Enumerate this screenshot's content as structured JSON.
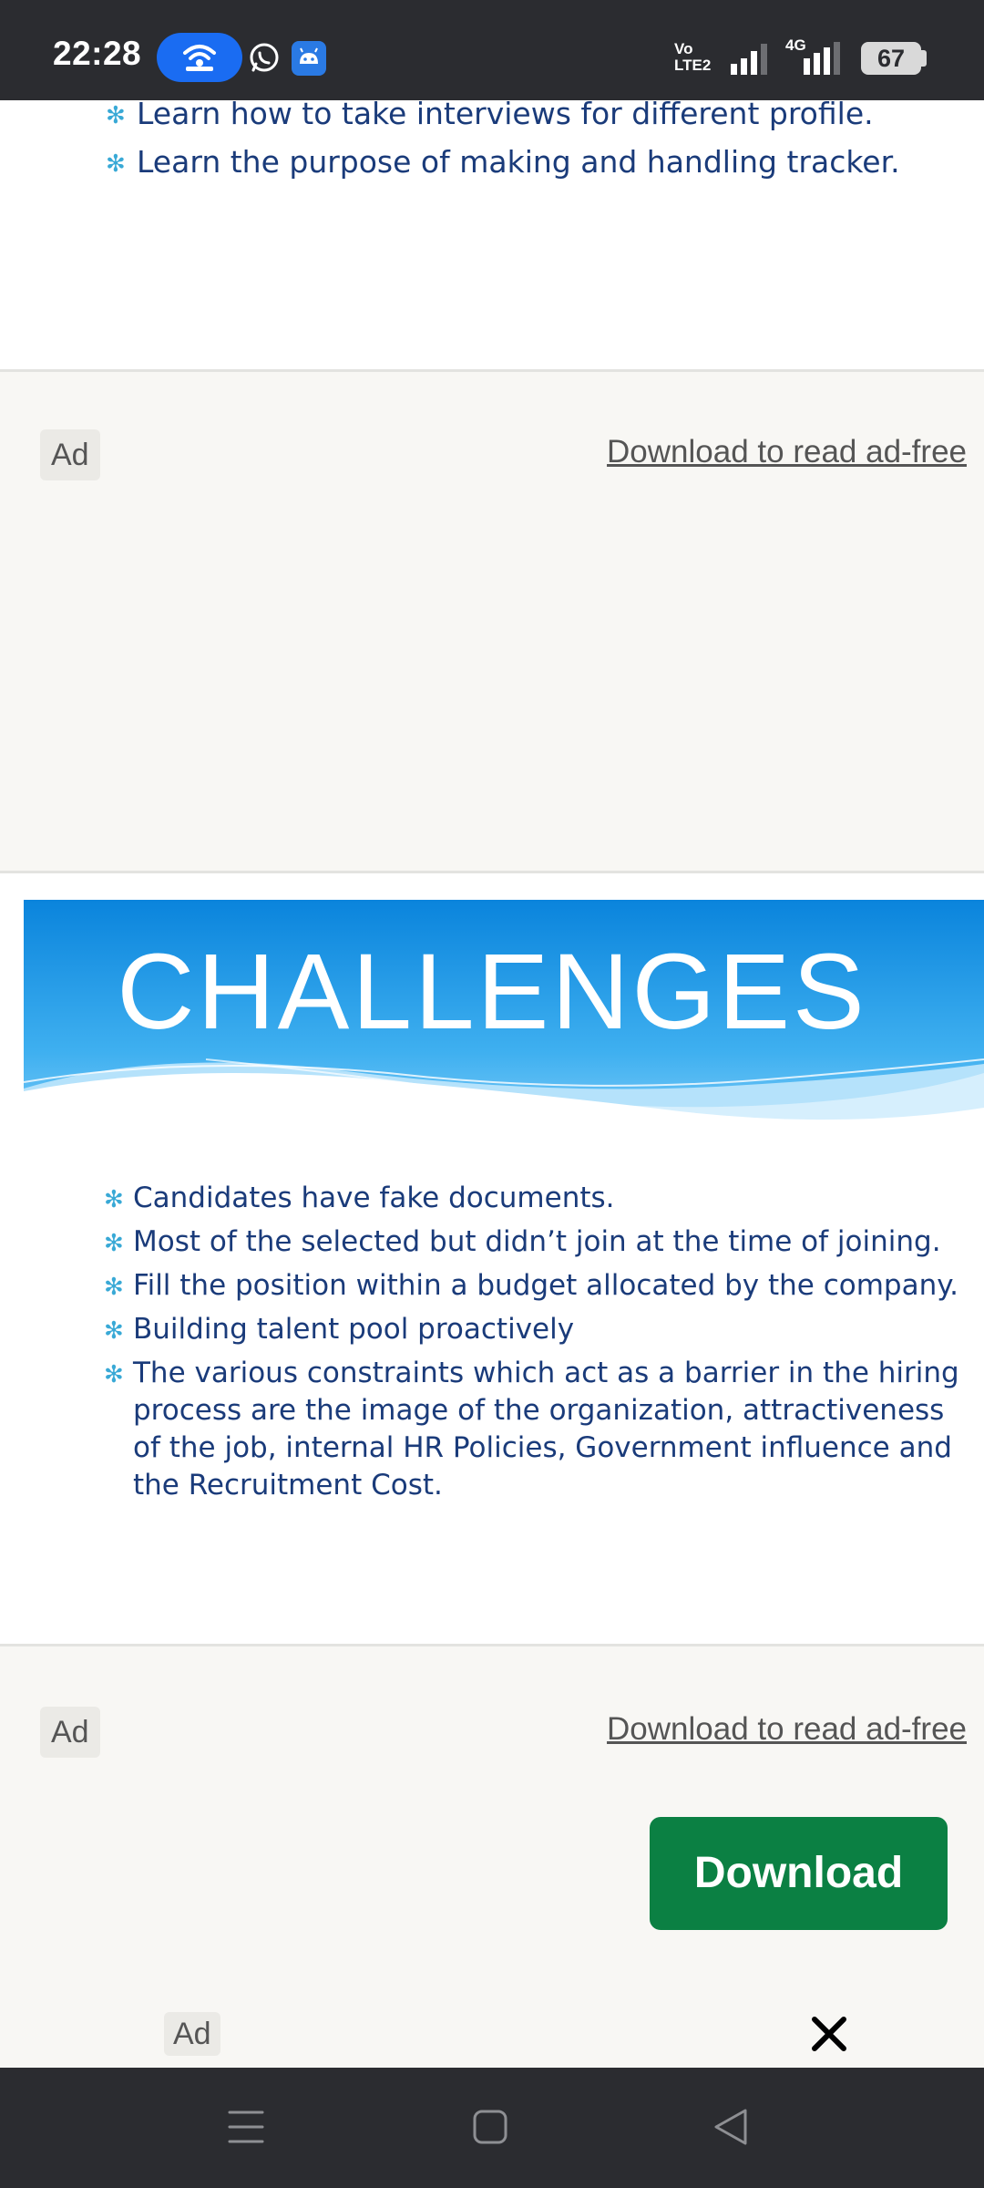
{
  "status_bar": {
    "time": "22:28",
    "volte_top": "Vo",
    "volte_bottom": "LTE2",
    "network_label": "4G",
    "battery": "67"
  },
  "slide_top": {
    "bullets": [
      "Learn how to take interviews for different profile.",
      "Learn the purpose of making and handling tracker."
    ]
  },
  "ad_1": {
    "badge": "Ad",
    "link": "Download to read ad-free"
  },
  "challenges": {
    "title": "CHALLENGES",
    "bullets": [
      [
        "Candidates have fake documents."
      ],
      [
        "Most of the selected but didn’t join at the time of joining."
      ],
      [
        "Fill the position within a budget allocated by the company."
      ],
      [
        "Building talent pool proactively"
      ],
      [
        "The various constraints which act as a barrier in the hiring",
        "process are the image of the organization, attractiveness",
        "of the job, internal HR Policies, Government influence and",
        "the Recruitment Cost."
      ]
    ]
  },
  "ad_2": {
    "badge": "Ad",
    "link": "Download to read ad-free",
    "button": "Download"
  },
  "ad_strip": {
    "badge": "Ad"
  },
  "icons": {
    "wifi": "wifi-hotspot-icon",
    "whatsapp": "whatsapp-icon",
    "android": "android-icon",
    "close": "close-icon",
    "menu": "menu-icon",
    "home": "home-icon",
    "back": "back-icon"
  },
  "colors": {
    "slide_text": "#1a3b7a",
    "bullet_star": "#39a9d6",
    "banner_blue": "#1e8fe0",
    "download_green": "#0b8043"
  }
}
